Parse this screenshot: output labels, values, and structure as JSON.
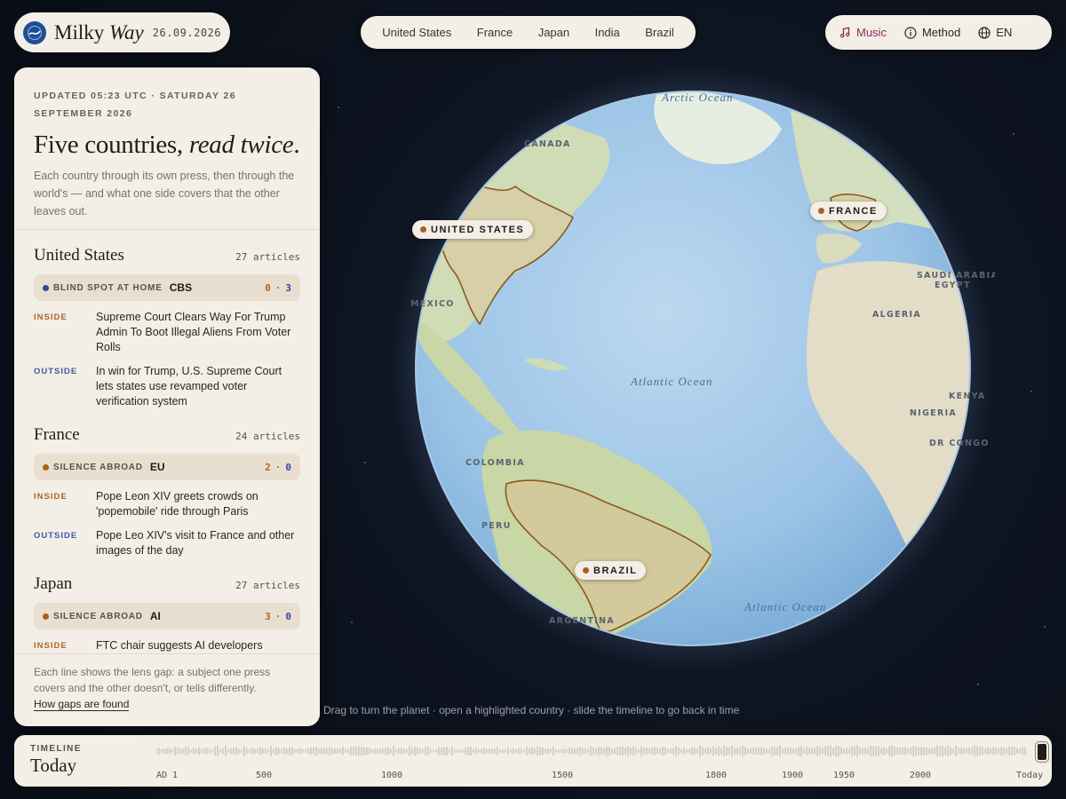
{
  "brand": {
    "name": "Milky",
    "name_italic": "Way",
    "date": "26.09.2026"
  },
  "nav": {
    "countries": [
      "United States",
      "France",
      "Japan",
      "India",
      "Brazil"
    ]
  },
  "tools": {
    "music": "Music",
    "method": "Method",
    "language": "EN"
  },
  "panel": {
    "updated": "UPDATED 05:23 UTC · SATURDAY 26 SEPTEMBER 2026",
    "headline_plain": "Five countries,",
    "headline_italic": "read twice",
    "headline_end": ".",
    "intro": "Each country through its own press, then through the world's — and what one side covers that the other leaves out.",
    "sections": [
      {
        "country": "United States",
        "count": "27 articles",
        "badge_label": "BLIND SPOT AT HOME",
        "badge_color": "#2f4a9a",
        "topic": "CBS",
        "inside_num": "0",
        "outside_num": "3",
        "inside_label": "INSIDE",
        "inside_text": "Supreme Court Clears Way For Trump Admin To Boot Illegal Aliens From Voter Rolls",
        "outside_label": "OUTSIDE",
        "outside_text": "In win for Trump, U.S. Supreme Court lets states use revamped voter verification system"
      },
      {
        "country": "France",
        "count": "24 articles",
        "badge_label": "SILENCE ABROAD",
        "badge_color": "#a8621c",
        "topic": "EU",
        "inside_num": "2",
        "outside_num": "0",
        "inside_label": "INSIDE",
        "inside_text": "Pope Leon XIV greets crowds on 'popemobile' ride through Paris",
        "outside_label": "OUTSIDE",
        "outside_text": "Pope Leo XIV's visit to France and other images of the day"
      },
      {
        "country": "Japan",
        "count": "27 articles",
        "badge_label": "SILENCE ABROAD",
        "badge_color": "#a8621c",
        "topic": "AI",
        "inside_num": "3",
        "outside_num": "0",
        "inside_label": "INSIDE",
        "inside_text": "FTC chair suggests AI developers"
      }
    ],
    "footer_text": "Each line shows the lens gap: a subject one press covers and the other doesn't, or tells differently.",
    "footer_link": "How gaps are found"
  },
  "map": {
    "labels": {
      "arctic": "Arctic Ocean",
      "canada": "CANADA",
      "mexico": "MEXICO",
      "atlantic1": "Atlantic Ocean",
      "atlantic2": "Atlantic Ocean",
      "colombia": "COLOMBIA",
      "peru": "PERU",
      "argentina": "ARGENTINA",
      "algeria": "ALGERIA",
      "saudi": "SAUDI ARABIA",
      "egypt": "EGYPT",
      "nigeria": "NIGERIA",
      "kenya": "KENYA",
      "drc": "DR CONGO"
    },
    "pins": {
      "us": "UNITED STATES",
      "france": "FRANCE",
      "brazil": "BRAZIL"
    },
    "hint": "Drag to turn the planet · open a highlighted country · slide the timeline to go back in time"
  },
  "timeline": {
    "label": "TIMELINE",
    "value": "Today",
    "ticks": [
      "AD 1",
      "500",
      "1000",
      "1500",
      "1800",
      "1900",
      "1950",
      "2000",
      "Today"
    ]
  }
}
